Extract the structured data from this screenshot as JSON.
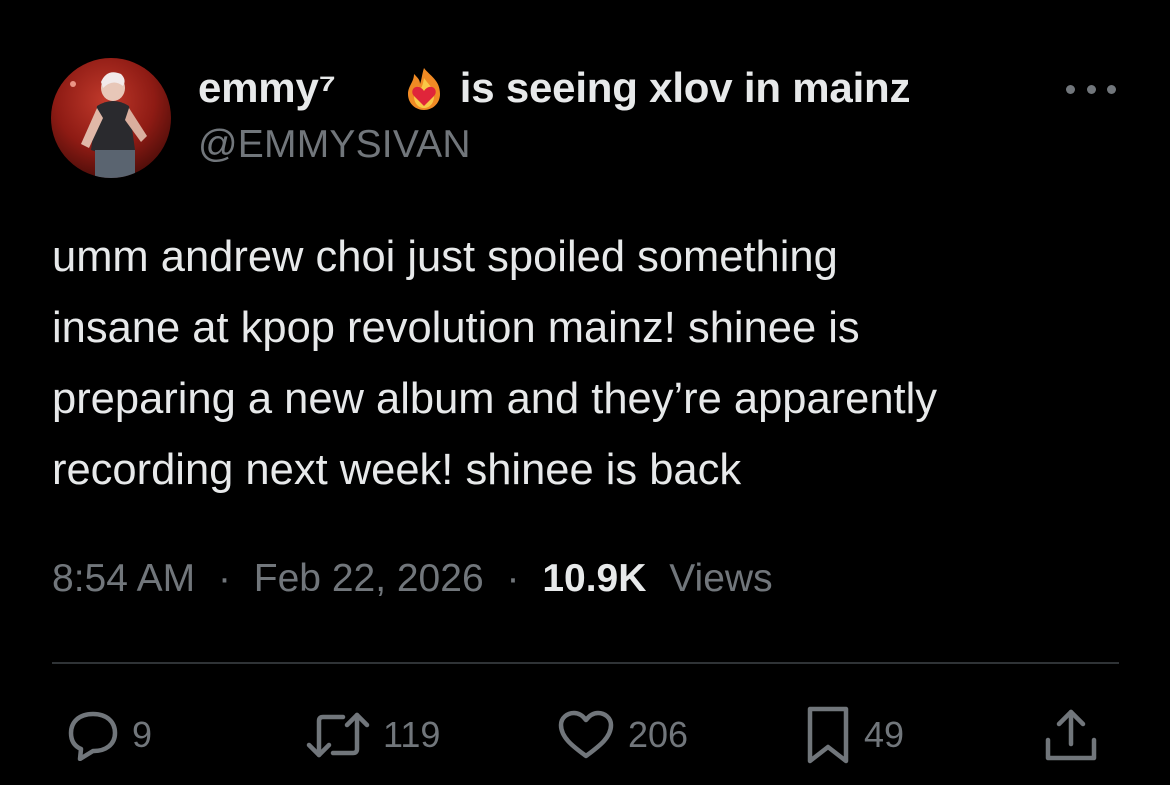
{
  "user": {
    "display_name": "emmy⁷",
    "status": "is seeing xlov in mainz",
    "handle": "@EMMYSIVAN"
  },
  "tweet": {
    "text_lines": [
      "umm andrew choi just spoiled something",
      "insane at kpop revolution mainz! shinee is",
      "preparing a new album and they’re apparently",
      "recording next week! shinee is back"
    ],
    "time": "8:54 AM",
    "date": "Feb 22, 2026",
    "separator": "·",
    "views_count": "10.9K",
    "views_label": "Views"
  },
  "actions": {
    "replies": "9",
    "retweets": "119",
    "likes": "206",
    "bookmarks": "49"
  },
  "icons": {
    "name_icons": [
      "crescent-moon-icon",
      "heart-on-fire-icon"
    ],
    "more": "more-dots-icon",
    "reply": "reply-icon",
    "retweet": "retweet-icon",
    "like": "heart-icon",
    "bookmark": "bookmark-icon",
    "share": "share-icon"
  },
  "colors": {
    "background": "#000000",
    "primary_text": "#e7e9ea",
    "secondary_text": "#71767b",
    "divider": "#2f3336"
  }
}
